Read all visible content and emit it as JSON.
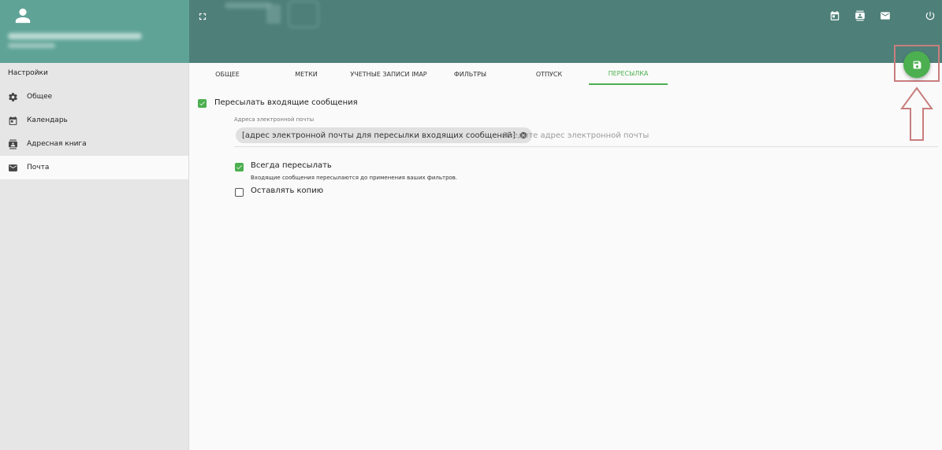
{
  "sidebar": {
    "title": "Настройки",
    "items": [
      {
        "label": "Общее",
        "icon": "gear-icon"
      },
      {
        "label": "Календарь",
        "icon": "calendar-icon"
      },
      {
        "label": "Адресная книга",
        "icon": "contacts-icon"
      },
      {
        "label": "Почта",
        "icon": "mail-icon",
        "active": true
      }
    ]
  },
  "tabs": [
    {
      "label": "Общее"
    },
    {
      "label": "Метки"
    },
    {
      "label": "Учетные записи IMAP"
    },
    {
      "label": "Фильтры"
    },
    {
      "label": "Отпуск"
    },
    {
      "label": "Пересылка",
      "active": true
    }
  ],
  "forwarding": {
    "enable_label": "Пересылать входящие сообщения",
    "enable_checked": true,
    "address_label": "Адреса электронной почты",
    "chip_text": "[адрес электронной почты для пересылки входящих сообщений]",
    "input_placeholder": "Введите адрес электронной почты",
    "always_label": "Всегда пересылать",
    "always_checked": true,
    "always_hint": "Входящие сообщения пересылаются до применения ваших фильтров.",
    "keep_copy_label": "Оставлять копию",
    "keep_copy_checked": false
  },
  "colors": {
    "header": "#4e8079",
    "side_header": "#5fa396",
    "accent": "#4caf50",
    "annotation": "#c97d7d"
  }
}
